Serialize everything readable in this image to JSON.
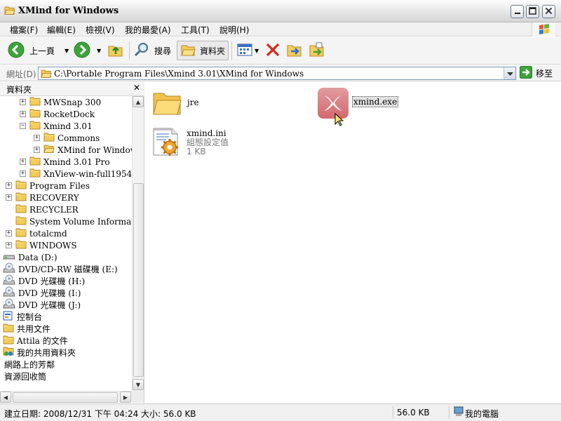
{
  "window": {
    "title": "XMind for Windows",
    "accent": "#3a6ea5"
  },
  "menu": {
    "items": [
      "檔案(F)",
      "編輯(E)",
      "檢視(V)",
      "我的最愛(A)",
      "工具(T)",
      "說明(H)"
    ]
  },
  "toolbar": {
    "back_label": "上一頁",
    "search_label": "搜尋",
    "folders_label": "資料夾"
  },
  "address": {
    "label": "網址(D)",
    "path": "C:\\Portable Program Files\\Xmind 3.01\\XMind for Windows",
    "go_label": "移至"
  },
  "folder_pane": {
    "title": "資料夾",
    "close": "✕",
    "items": [
      {
        "label": "MWSnap 300",
        "level": 2,
        "expander": "+",
        "icon": "folder-icon"
      },
      {
        "label": "RocketDock",
        "level": 2,
        "expander": "+",
        "icon": "folder-icon"
      },
      {
        "label": "Xmind 3.01",
        "level": 2,
        "expander": "−",
        "icon": "folder-icon"
      },
      {
        "label": "Commons",
        "level": 3,
        "expander": "+",
        "icon": "folder-icon"
      },
      {
        "label": "XMind for Windows",
        "level": 3,
        "expander": "+",
        "icon": "folder-open-icon",
        "selected": true
      },
      {
        "label": "Xmind 3.01 Pro",
        "level": 2,
        "expander": "+",
        "icon": "folder-icon"
      },
      {
        "label": "XnView-win-full1954",
        "level": 2,
        "expander": "+",
        "icon": "folder-icon"
      },
      {
        "label": "Program Files",
        "level": 1,
        "expander": "+",
        "icon": "folder-icon"
      },
      {
        "label": "RECOVERY",
        "level": 1,
        "expander": "+",
        "icon": "folder-icon"
      },
      {
        "label": "RECYCLER",
        "level": 1,
        "expander": "",
        "icon": "folder-icon"
      },
      {
        "label": "System Volume Information",
        "level": 1,
        "expander": "",
        "icon": "folder-icon"
      },
      {
        "label": "totalcmd",
        "level": 1,
        "expander": "+",
        "icon": "folder-icon"
      },
      {
        "label": "WINDOWS",
        "level": 1,
        "expander": "+",
        "icon": "folder-icon"
      },
      {
        "label": "Data (D:)",
        "level": 0,
        "expander": "",
        "icon": "drive-icon"
      },
      {
        "label": "DVD/CD-RW 磁碟機 (E:)",
        "level": 0,
        "expander": "",
        "icon": "cd-drive-icon"
      },
      {
        "label": "DVD 光碟機 (H:)",
        "level": 0,
        "expander": "",
        "icon": "cd-drive-icon"
      },
      {
        "label": "DVD 光碟機 (I:)",
        "level": 0,
        "expander": "",
        "icon": "cd-drive-icon"
      },
      {
        "label": "DVD 光碟機 (J:)",
        "level": 0,
        "expander": "",
        "icon": "cd-drive-icon"
      },
      {
        "label": "控制台",
        "level": -1,
        "expander": "",
        "icon": "control-panel-icon"
      },
      {
        "label": "共用文件",
        "level": -1,
        "expander": "",
        "icon": "folder-icon"
      },
      {
        "label": "Attila 的文件",
        "level": -1,
        "expander": "",
        "icon": "folder-icon"
      },
      {
        "label": "我的共用資料夾",
        "level": -1,
        "expander": "",
        "icon": "shared-folder-icon"
      },
      {
        "label": "網路上的芳鄰",
        "level": -2,
        "expander": "",
        "icon": "none"
      },
      {
        "label": "資源回收筒",
        "level": -2,
        "expander": "",
        "icon": "none"
      }
    ]
  },
  "files": [
    {
      "name": "jre",
      "icon": "folder-icon",
      "details": []
    },
    {
      "name": "xmind.exe",
      "icon": "xmind-app-icon",
      "details": [],
      "selected": true
    },
    {
      "name": "xmind.ini",
      "icon": "config-file-icon",
      "details": [
        "組態設定值",
        "1 KB"
      ]
    }
  ],
  "status": {
    "left": "建立日期: 2008/12/31 下午 04:24 大小: 56.0 KB",
    "size": "56.0 KB",
    "zone": "我的電腦"
  }
}
